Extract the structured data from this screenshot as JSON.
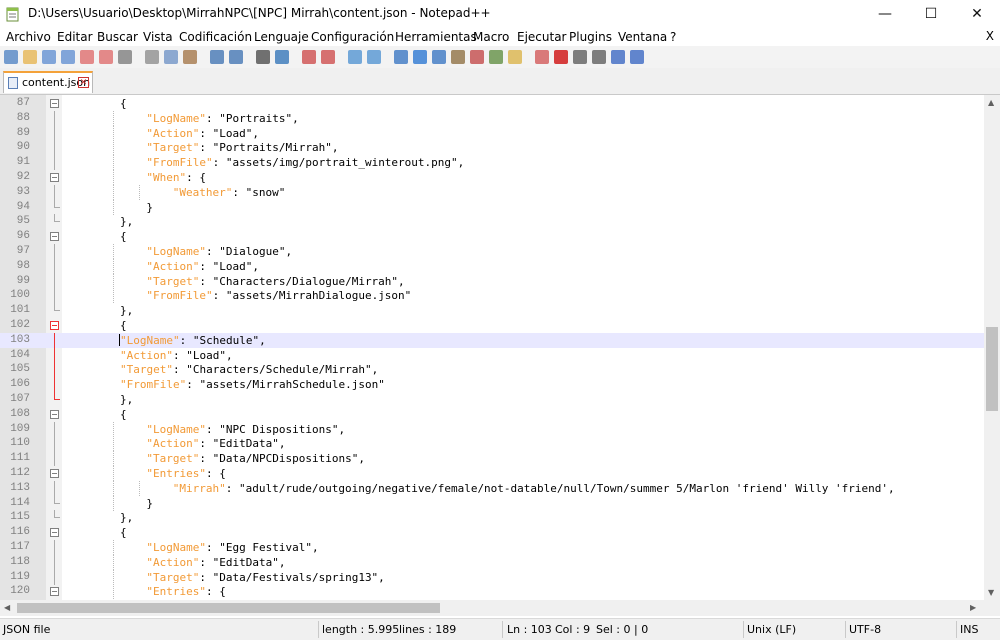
{
  "window": {
    "title": "D:\\Users\\Usuario\\Desktop\\MirrahNPC\\[NPC] Mirrah\\content.json - Notepad++",
    "minimize": "—",
    "maximize": "☐",
    "close": "✕"
  },
  "menu": [
    "Archivo",
    "Editar",
    "Buscar",
    "Vista",
    "Codificación",
    "Lenguaje",
    "Configuración",
    "Herramientas",
    "Macro",
    "Ejecutar",
    "Plugins",
    "Ventana",
    "?"
  ],
  "menu_close": "X",
  "toolbar_icons": [
    "new-icon",
    "open-icon",
    "save-icon",
    "save-all-icon",
    "close-icon",
    "close-all-icon",
    "print-icon",
    "cut-icon",
    "copy-icon",
    "paste-icon",
    "undo-icon",
    "redo-icon",
    "find-icon",
    "replace-icon",
    "zoom-in-icon",
    "zoom-out-icon",
    "sync-vertical-icon",
    "sync-horizontal-icon",
    "word-wrap-icon",
    "show-all-chars-icon",
    "indent-guide-icon",
    "language-icon",
    "doc-map-icon",
    "function-list-icon",
    "folder-workspace-icon",
    "monitor-icon",
    "record-macro-icon",
    "stop-macro-icon",
    "play-macro-icon",
    "run-macro-multiple-icon",
    "save-macro-icon"
  ],
  "tab": {
    "label": "content.json",
    "close": "✕"
  },
  "lines": [
    {
      "n": "87",
      "indent": 4,
      "parts": [
        [
          "p",
          "{"
        ]
      ],
      "fold": "box"
    },
    {
      "n": "88",
      "indent": 6,
      "parts": [
        [
          "k",
          "\"LogName\""
        ],
        [
          "p",
          ": \"Portraits\","
        ]
      ],
      "fold": "line"
    },
    {
      "n": "89",
      "indent": 6,
      "parts": [
        [
          "k",
          "\"Action\""
        ],
        [
          "p",
          ": \"Load\","
        ]
      ],
      "fold": "line"
    },
    {
      "n": "90",
      "indent": 6,
      "parts": [
        [
          "k",
          "\"Target\""
        ],
        [
          "p",
          ": \"Portraits/Mirrah\","
        ]
      ],
      "fold": "line"
    },
    {
      "n": "91",
      "indent": 6,
      "parts": [
        [
          "k",
          "\"FromFile\""
        ],
        [
          "p",
          ": \"assets/img/portrait_winterout.png\","
        ]
      ],
      "fold": "line"
    },
    {
      "n": "92",
      "indent": 6,
      "parts": [
        [
          "k",
          "\"When\""
        ],
        [
          "p",
          ": {"
        ]
      ],
      "fold": "box"
    },
    {
      "n": "93",
      "indent": 8,
      "parts": [
        [
          "k",
          "\"Weather\""
        ],
        [
          "p",
          ": \"snow\""
        ]
      ],
      "fold": "line"
    },
    {
      "n": "94",
      "indent": 6,
      "parts": [
        [
          "p",
          "}"
        ]
      ],
      "fold": "end"
    },
    {
      "n": "95",
      "indent": 4,
      "parts": [
        [
          "p",
          "},"
        ]
      ],
      "fold": "end"
    },
    {
      "n": "96",
      "indent": 4,
      "parts": [
        [
          "p",
          "{"
        ]
      ],
      "fold": "box"
    },
    {
      "n": "97",
      "indent": 6,
      "parts": [
        [
          "k",
          "\"LogName\""
        ],
        [
          "p",
          ": \"Dialogue\","
        ]
      ],
      "fold": "line"
    },
    {
      "n": "98",
      "indent": 6,
      "parts": [
        [
          "k",
          "\"Action\""
        ],
        [
          "p",
          ": \"Load\","
        ]
      ],
      "fold": "line"
    },
    {
      "n": "99",
      "indent": 6,
      "parts": [
        [
          "k",
          "\"Target\""
        ],
        [
          "p",
          ": \"Characters/Dialogue/Mirrah\","
        ]
      ],
      "fold": "line"
    },
    {
      "n": "100",
      "indent": 6,
      "parts": [
        [
          "k",
          "\"FromFile\""
        ],
        [
          "p",
          ": \"assets/MirrahDialogue.json\""
        ]
      ],
      "fold": "line"
    },
    {
      "n": "101",
      "indent": 4,
      "parts": [
        [
          "p",
          "},"
        ]
      ],
      "fold": "end"
    },
    {
      "n": "102",
      "indent": 4,
      "parts": [
        [
          "p",
          "{"
        ]
      ],
      "fold": "boxred"
    },
    {
      "n": "103",
      "indent": 4,
      "parts": [
        [
          "k",
          "\"LogName\""
        ],
        [
          "p",
          ": \"Schedule\","
        ]
      ],
      "fold": "linered",
      "current": true,
      "caret": true
    },
    {
      "n": "104",
      "indent": 4,
      "parts": [
        [
          "k",
          "\"Action\""
        ],
        [
          "p",
          ": \"Load\","
        ]
      ],
      "fold": "linered"
    },
    {
      "n": "105",
      "indent": 4,
      "parts": [
        [
          "k",
          "\"Target\""
        ],
        [
          "p",
          ": \"Characters/Schedule/Mirrah\","
        ]
      ],
      "fold": "linered"
    },
    {
      "n": "106",
      "indent": 4,
      "parts": [
        [
          "k",
          "\"FromFile\""
        ],
        [
          "p",
          ": \"assets/MirrahSchedule.json\""
        ]
      ],
      "fold": "linered"
    },
    {
      "n": "107",
      "indent": 4,
      "parts": [
        [
          "p",
          "},"
        ]
      ],
      "fold": "endred"
    },
    {
      "n": "108",
      "indent": 4,
      "parts": [
        [
          "p",
          "{"
        ]
      ],
      "fold": "box"
    },
    {
      "n": "109",
      "indent": 6,
      "parts": [
        [
          "k",
          "\"LogName\""
        ],
        [
          "p",
          ": \"NPC Dispositions\","
        ]
      ],
      "fold": "line"
    },
    {
      "n": "110",
      "indent": 6,
      "parts": [
        [
          "k",
          "\"Action\""
        ],
        [
          "p",
          ": \"EditData\","
        ]
      ],
      "fold": "line"
    },
    {
      "n": "111",
      "indent": 6,
      "parts": [
        [
          "k",
          "\"Target\""
        ],
        [
          "p",
          ": \"Data/NPCDispositions\","
        ]
      ],
      "fold": "line"
    },
    {
      "n": "112",
      "indent": 6,
      "parts": [
        [
          "k",
          "\"Entries\""
        ],
        [
          "p",
          ": {"
        ]
      ],
      "fold": "box"
    },
    {
      "n": "113",
      "indent": 8,
      "parts": [
        [
          "k",
          "\"Mirrah\""
        ],
        [
          "p",
          ": \"adult/rude/outgoing/negative/female/not-datable/null/Town/summer 5/Marlon 'friend' Willy 'friend',"
        ]
      ],
      "fold": "line"
    },
    {
      "n": "114",
      "indent": 6,
      "parts": [
        [
          "p",
          "}"
        ]
      ],
      "fold": "end"
    },
    {
      "n": "115",
      "indent": 4,
      "parts": [
        [
          "p",
          "},"
        ]
      ],
      "fold": "end"
    },
    {
      "n": "116",
      "indent": 4,
      "parts": [
        [
          "p",
          "{"
        ]
      ],
      "fold": "box"
    },
    {
      "n": "117",
      "indent": 6,
      "parts": [
        [
          "k",
          "\"LogName\""
        ],
        [
          "p",
          ": \"Egg Festival\","
        ]
      ],
      "fold": "line"
    },
    {
      "n": "118",
      "indent": 6,
      "parts": [
        [
          "k",
          "\"Action\""
        ],
        [
          "p",
          ": \"EditData\","
        ]
      ],
      "fold": "line"
    },
    {
      "n": "119",
      "indent": 6,
      "parts": [
        [
          "k",
          "\"Target\""
        ],
        [
          "p",
          ": \"Data/Festivals/spring13\","
        ]
      ],
      "fold": "line"
    },
    {
      "n": "120",
      "indent": 6,
      "parts": [
        [
          "k",
          "\"Entries\""
        ],
        [
          "p",
          ": {"
        ]
      ],
      "fold": "box"
    }
  ],
  "status": {
    "filetype": "JSON file",
    "length": "length : 5.995",
    "lines": "lines : 189",
    "ln": "Ln : 103",
    "col": "Col : 9",
    "sel": "Sel : 0 | 0",
    "eol": "Unix (LF)",
    "encoding": "UTF-8",
    "mode": "INS"
  },
  "colors": {
    "key": "#f29a36",
    "current_line": "#e8e8ff",
    "tab_accent": "#f4a23a",
    "fold_active": "#e33333"
  }
}
